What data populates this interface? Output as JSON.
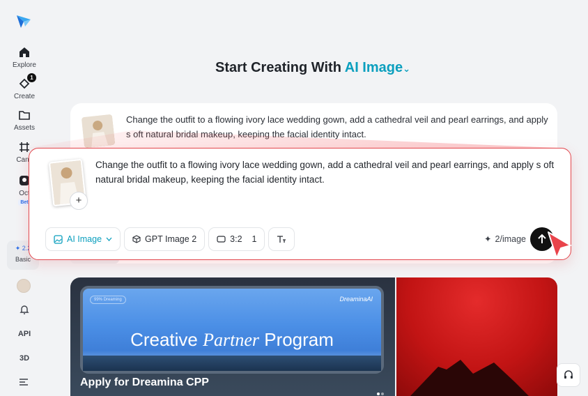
{
  "sidebar": {
    "items": [
      {
        "label": "Explore",
        "icon": "home-icon"
      },
      {
        "label": "Create",
        "icon": "create-icon",
        "badge": "1"
      },
      {
        "label": "Assets",
        "icon": "folder-icon"
      },
      {
        "label": "Canv",
        "icon": "canvas-icon"
      },
      {
        "label": "Oct",
        "icon": "agent-icon",
        "tag": "Bet"
      }
    ],
    "credits": "2.2",
    "plan": "Basic",
    "api_label": "API",
    "threed_label": "3D"
  },
  "header": {
    "title_prefix": "Start Creating With",
    "title_accent": "AI Image",
    "caret": "⌄"
  },
  "background_card": {
    "prompt": "Change the outfit to a flowing ivory lace wedding gown, add a cathedral veil and pearl earrings, and apply s oft natural bridal makeup, keeping the facial identity intact."
  },
  "composer": {
    "prompt": "Change the outfit to a flowing ivory lace wedding gown, add a cathedral veil and pearl earrings, and apply s oft natural bridal makeup, keeping the facial identity intact.",
    "add_label": "+",
    "mode_label": "AI Image",
    "model_label": "GPT Image 2",
    "ratio_label": "3:2",
    "count_label": "1",
    "cost_label": "2/image"
  },
  "banner": {
    "tag": "99% Dreaming",
    "brand": "DreaminaAI",
    "title_a": "Creative ",
    "title_b": "Partner",
    "title_c": " Program",
    "cta": "Apply for Dreamina CPP"
  },
  "colors": {
    "accent": "#0b9fbe",
    "highlight": "#e2474d"
  }
}
